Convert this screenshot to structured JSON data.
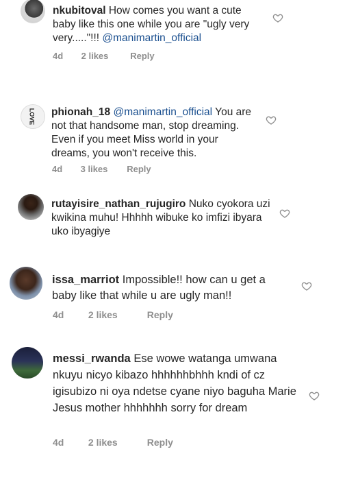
{
  "comments": [
    {
      "username": "nkubitoval",
      "text": "How comes you want a cute baby like this one while you are \"ugly very very.....\"!!!",
      "mention": "@manimartin_official",
      "time": "4d",
      "likes": "2 likes",
      "reply": "Reply"
    },
    {
      "username": "phionah_18",
      "mention": "@manimartin_official",
      "text": "You are not that handsome man, stop dreaming. Even if you meet Miss world in your dreams, you won't receive this.",
      "time": "4d",
      "likes": "3 likes",
      "reply": "Reply",
      "avatar_text": "LOVE"
    },
    {
      "username": "rutayisire_nathan_rujugiro",
      "text": "Nuko cyokora uzi kwikina muhu! Hhhhh wibuke ko imfizi ibyara uko ibyagiye"
    },
    {
      "username": "issa_marriot",
      "text": "Impossible!! how can u get a baby like that while u are  ugly man!!",
      "time": "4d",
      "likes": "2 likes",
      "reply": "Reply"
    },
    {
      "username": "messi_rwanda",
      "text": "Ese wowe watanga umwana nkuyu nicyo kibazo hhhhhhbhhh kndi of cz igisubizo ni oya ndetse cyane niyo baguha Marie Jesus mother hhhhhhh sorry for dream",
      "time": "4d",
      "likes": "2 likes",
      "reply": "Reply"
    }
  ],
  "colors": {
    "text": "#262626",
    "meta": "#8e8e8e",
    "mention": "#1a4f8f",
    "background": "#ffffff"
  },
  "icons": {
    "like": "heart-outline-icon"
  }
}
